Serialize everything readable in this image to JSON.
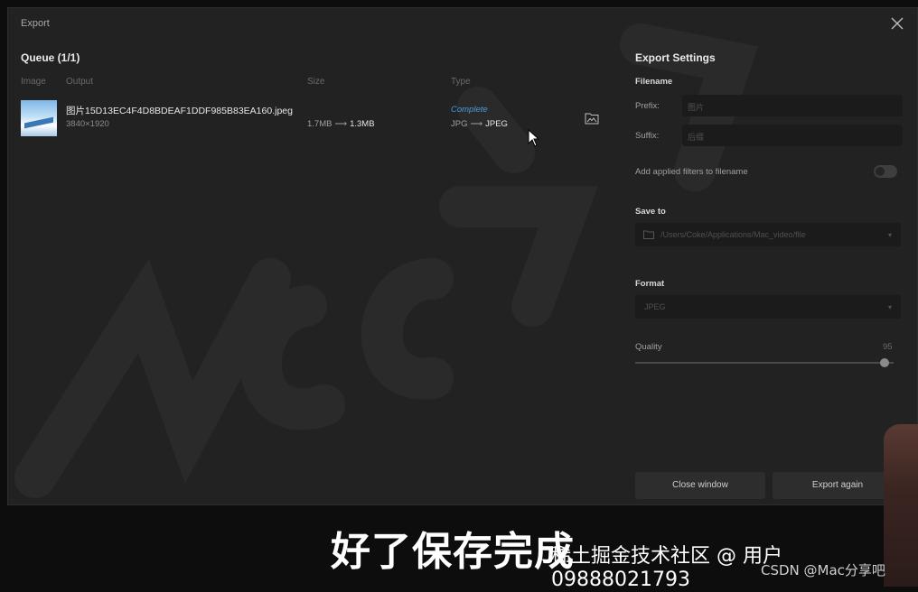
{
  "window": {
    "title": "Export"
  },
  "queue": {
    "title": "Queue (1/1)",
    "headers": {
      "image": "Image",
      "output": "Output",
      "size": "Size",
      "type": "Type"
    },
    "items": [
      {
        "filename": "图片15D13EC4F4D8BDEAF1DDF985B83EA160.jpeg",
        "dimensions": "3840×1920",
        "size_from": "1.7MB",
        "size_to": "1.3MB",
        "status": "Complete",
        "type_from": "JPG",
        "type_to": "JPEG"
      }
    ]
  },
  "settings": {
    "title": "Export Settings",
    "filename_label": "Filename",
    "prefix_label": "Prefix:",
    "prefix_placeholder": "图片",
    "suffix_label": "Suffix:",
    "suffix_placeholder": "后缀",
    "filters_label": "Add applied filters to filename",
    "filters_enabled": false,
    "save_to_label": "Save to",
    "save_path": "/Users/Coke/Applications/Mac_video/file",
    "format_label": "Format",
    "format_value": "JPEG",
    "quality_label": "Quality",
    "quality_value": "95",
    "close_button": "Close window",
    "export_again_button": "Export again"
  },
  "overlay": {
    "subtitle": "好了保存完成",
    "watermark_user": "稀土掘金技术社区 @ 用户09888021793",
    "watermark_site": "CSDN @Mac分享吧"
  },
  "icons": [
    "close-icon",
    "open-folder-icon",
    "mouse-cursor-icon",
    "folder-icon",
    "chevron-down-icon"
  ],
  "colors": {
    "window_bg": "#222222",
    "accent_complete": "#4a9bd8",
    "field_bg": "#1b1b1b",
    "button_bg": "#2d2d2d"
  }
}
